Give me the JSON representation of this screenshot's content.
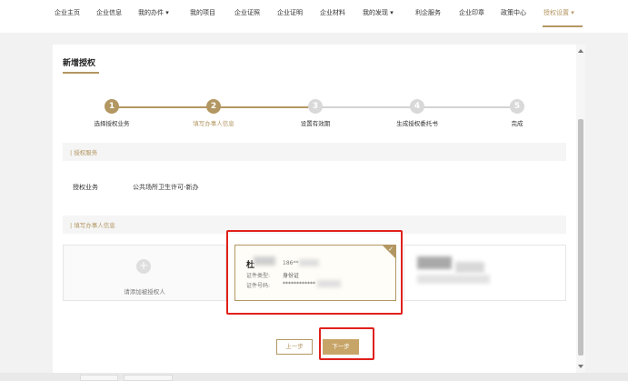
{
  "nav": {
    "items": [
      {
        "label": "企业主页",
        "dropdown": false
      },
      {
        "label": "企业信息",
        "dropdown": false
      },
      {
        "label": "我的办件",
        "dropdown": true
      },
      {
        "label": "我的项目",
        "dropdown": false
      },
      {
        "label": "企业证照",
        "dropdown": false
      },
      {
        "label": "企业证明",
        "dropdown": false
      },
      {
        "label": "企业材料",
        "dropdown": false
      },
      {
        "label": "我的发现",
        "dropdown": true
      },
      {
        "label": "利企服务",
        "dropdown": false
      },
      {
        "label": "企业印章",
        "dropdown": false
      },
      {
        "label": "政策中心",
        "dropdown": false
      },
      {
        "label": "授权设置",
        "dropdown": true,
        "active": true
      }
    ],
    "dropdown_glyph": "▾"
  },
  "page": {
    "title": "新增授权"
  },
  "steps": [
    {
      "number": "1",
      "label": "选择授权业务",
      "state": "done"
    },
    {
      "number": "2",
      "label": "填写办事人信息",
      "state": "current"
    },
    {
      "number": "3",
      "label": "设置有效期",
      "state": "todo"
    },
    {
      "number": "4",
      "label": "生成授权委托书",
      "state": "todo"
    },
    {
      "number": "5",
      "label": "完成",
      "state": "todo"
    }
  ],
  "sections": {
    "service": "| 授权服务",
    "agent": "| 填写办事人信息"
  },
  "service_row": {
    "label": "授权业务",
    "value": "公共场所卫生许可-新办"
  },
  "add_agent": {
    "label": "请添加被授权人",
    "icon": "plus-icon"
  },
  "agent_card": {
    "name": "杜",
    "phone": "186**",
    "id_type_label": "证件类型:",
    "id_type_value": "身份证",
    "id_no_label": "证件号码:",
    "id_no_value": "************",
    "selected": true,
    "check_glyph": "✓"
  },
  "buttons": {
    "prev": "上一步",
    "next": "下一步"
  },
  "colors": {
    "accent": "#b39762",
    "accent_fill": "#c7a568",
    "inactive_step": "#d3d3d3",
    "highlight": "#e0201b"
  }
}
